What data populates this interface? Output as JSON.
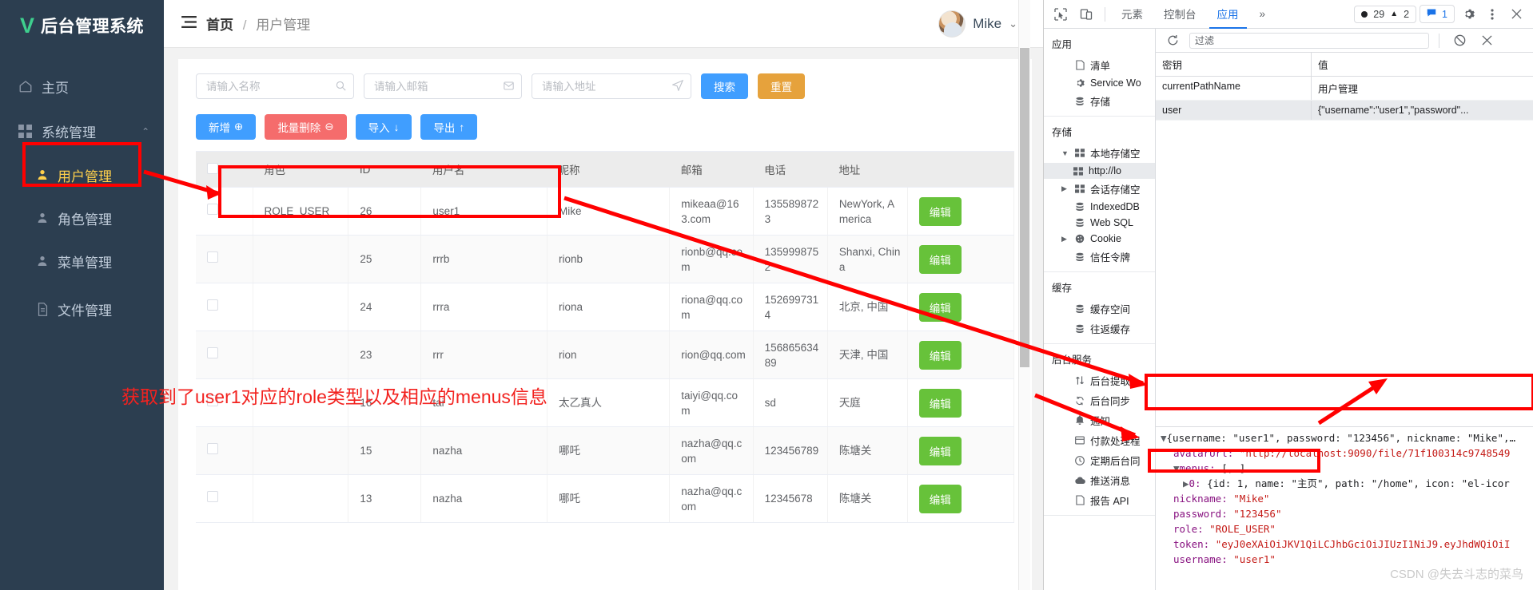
{
  "sidebar": {
    "brand": {
      "logo": "V",
      "title": "后台管理系统"
    },
    "items": [
      {
        "label": "主页",
        "icon": "home-icon"
      },
      {
        "label": "系统管理",
        "icon": "grid-icon"
      }
    ],
    "sub_items": [
      {
        "label": "用户管理",
        "icon": "user-icon",
        "active": true
      },
      {
        "label": "角色管理",
        "icon": "user-icon",
        "active": false
      },
      {
        "label": "菜单管理",
        "icon": "user-icon",
        "active": false
      },
      {
        "label": "文件管理",
        "icon": "file-icon",
        "active": false
      }
    ]
  },
  "topbar": {
    "menu_icon": "hamburger-icon",
    "breadcrumb_root": "首页",
    "breadcrumb_sep": "/",
    "breadcrumb_current": "用户管理",
    "user_name": "Mike",
    "caret_icon": "chevron-down-icon"
  },
  "search": {
    "name_placeholder": "请输入名称",
    "name_value": "",
    "name_icon": "search-icon",
    "email_placeholder": "请输入邮箱",
    "email_value": "",
    "email_icon": "message-icon",
    "address_placeholder": "请输入地址",
    "address_value": "",
    "address_icon": "location-icon",
    "search_label": "搜索",
    "reset_label": "重置"
  },
  "actions": [
    {
      "label": "新增",
      "glyph": "⊕",
      "color": "blue"
    },
    {
      "label": "批量删除",
      "glyph": "⊖",
      "color": "red"
    },
    {
      "label": "导入",
      "glyph": "↓",
      "color": "blue"
    },
    {
      "label": "导出",
      "glyph": "↑",
      "color": "blue"
    }
  ],
  "table": {
    "columns": [
      "",
      "角色",
      "ID",
      "用户名",
      "昵称",
      "邮箱",
      "电话",
      "地址",
      ""
    ],
    "edit_label": "编辑",
    "rows": [
      {
        "role": "ROLE_USER",
        "id": "26",
        "username": "user1",
        "nickname": "Mike",
        "email": "mikeaa@163.com",
        "phone": "1355898723",
        "address": "NewYork, America"
      },
      {
        "role": "",
        "id": "25",
        "username": "rrrb",
        "nickname": "rionb",
        "email": "rionb@qq.com",
        "phone": "1359998752",
        "address": "Shanxi, China"
      },
      {
        "role": "",
        "id": "24",
        "username": "rrra",
        "nickname": "riona",
        "email": "riona@qq.com",
        "phone": "1526997314",
        "address": "北京, 中国"
      },
      {
        "role": "",
        "id": "23",
        "username": "rrr",
        "nickname": "rion",
        "email": "rion@qq.com",
        "phone": "15686563489",
        "address": "天津, 中国"
      },
      {
        "role": "",
        "id": "16",
        "username": "tai",
        "nickname": "太乙真人",
        "email": "taiyi@qq.com",
        "phone": "sd",
        "address": "天庭"
      },
      {
        "role": "",
        "id": "15",
        "username": "nazha",
        "nickname": "哪吒",
        "email": "nazha@qq.com",
        "phone": "123456789",
        "address": "陈塘关"
      },
      {
        "role": "",
        "id": "13",
        "username": "nazha",
        "nickname": "哪吒",
        "email": "nazha@qq.com",
        "phone": "12345678",
        "address": "陈塘关"
      }
    ]
  },
  "annotation": {
    "text": "获取到了user1对应的role类型以及相应的menus信息",
    "color": "#f2221f"
  },
  "devtools": {
    "toolbar": {
      "inspect_icon": "inspect-icon",
      "device_icon": "device-toolbar-icon",
      "tabs": [
        {
          "label": "元素",
          "active": false
        },
        {
          "label": "控制台",
          "active": false
        },
        {
          "label": "应用",
          "active": true
        }
      ],
      "more_tabs": "»",
      "errors": "29",
      "warnings": "2",
      "messages": "1",
      "settings_icon": "gear-icon",
      "kebab_icon": "more-vertical-icon",
      "close_icon": "close-icon"
    },
    "sidebar": {
      "sections": [
        {
          "title": "应用",
          "items": [
            {
              "label": "清单",
              "icon": "file-icon",
              "tri": "",
              "selected": false
            },
            {
              "label": "Service Wo",
              "icon": "gear-icon",
              "tri": "",
              "selected": false
            },
            {
              "label": "存储",
              "icon": "database-icon",
              "tri": "",
              "selected": false
            }
          ]
        },
        {
          "title": "存储",
          "items": [
            {
              "label": "本地存储空",
              "icon": "table-icon",
              "tri": "▼",
              "selected": false
            },
            {
              "label": "http://lo",
              "icon": "table-icon",
              "tri": "",
              "selected": true,
              "indent": true
            },
            {
              "label": "会话存储空",
              "icon": "table-icon",
              "tri": "▶",
              "selected": false
            },
            {
              "label": "IndexedDB",
              "icon": "database-icon",
              "tri": "",
              "selected": false
            },
            {
              "label": "Web SQL",
              "icon": "database-icon",
              "tri": "",
              "selected": false
            },
            {
              "label": "Cookie",
              "icon": "cookie-icon",
              "tri": "▶",
              "selected": false
            },
            {
              "label": "信任令牌",
              "icon": "database-icon",
              "tri": "",
              "selected": false
            }
          ]
        },
        {
          "title": "缓存",
          "items": [
            {
              "label": "缓存空间",
              "icon": "database-icon",
              "tri": "",
              "selected": false
            },
            {
              "label": "往返缓存",
              "icon": "database-icon",
              "tri": "",
              "selected": false
            }
          ]
        },
        {
          "title": "后台服务",
          "items": [
            {
              "label": "后台提取",
              "icon": "updown-arrows-icon",
              "tri": "",
              "selected": false
            },
            {
              "label": "后台同步",
              "icon": "sync-icon",
              "tri": "",
              "selected": false
            },
            {
              "label": "通知",
              "icon": "bell-icon",
              "tri": "",
              "selected": false
            },
            {
              "label": "付款处理程",
              "icon": "card-icon",
              "tri": "",
              "selected": false
            },
            {
              "label": "定期后台同",
              "icon": "clock-icon",
              "tri": "",
              "selected": false
            },
            {
              "label": "推送消息",
              "icon": "cloud-icon",
              "tri": "",
              "selected": false
            },
            {
              "label": "报告 API",
              "icon": "file-icon",
              "tri": "",
              "selected": false
            }
          ]
        }
      ]
    },
    "filter": {
      "refresh_icon": "refresh-icon",
      "placeholder": "过滤",
      "value": "",
      "clear_all_icon": "no-entry-icon",
      "delete_icon": "close-icon"
    },
    "storage_table": {
      "key_header": "密钥",
      "value_header": "值",
      "rows": [
        {
          "key": "currentPathName",
          "value": "用户管理",
          "selected": false
        },
        {
          "key": "user",
          "value": "{\"username\":\"user1\",\"password\"...",
          "selected": true
        }
      ]
    },
    "preview": {
      "line0_tri": "▼",
      "line0": "{username: \"user1\", password: \"123456\", nickname: \"Mike\",…",
      "line1_key": "avatarUrl:",
      "line1_val": "\"http://localhost:9090/file/71f100314c9748549",
      "line2_tri": "▼",
      "line2_key": "menus:",
      "line2_val": "[,…]",
      "line3_tri": "▶",
      "line3_key": "0:",
      "line3_val": "{id: 1, name: \"主页\", path: \"/home\", icon: \"el-icor",
      "line4_key": "nickname:",
      "line4_val": "\"Mike\"",
      "line5_key": "password:",
      "line5_val": "\"123456\"",
      "line6_key": "role:",
      "line6_val": "\"ROLE_USER\"",
      "line7_key": "token:",
      "line7_val": "\"eyJ0eXAiOiJKV1QiLCJhbGciOiJIUzI1NiJ9.eyJhdWQiOiI",
      "line8_key": "username:",
      "line8_val": "\"user1\""
    }
  },
  "watermark": "CSDN @失去斗志的菜鸟"
}
